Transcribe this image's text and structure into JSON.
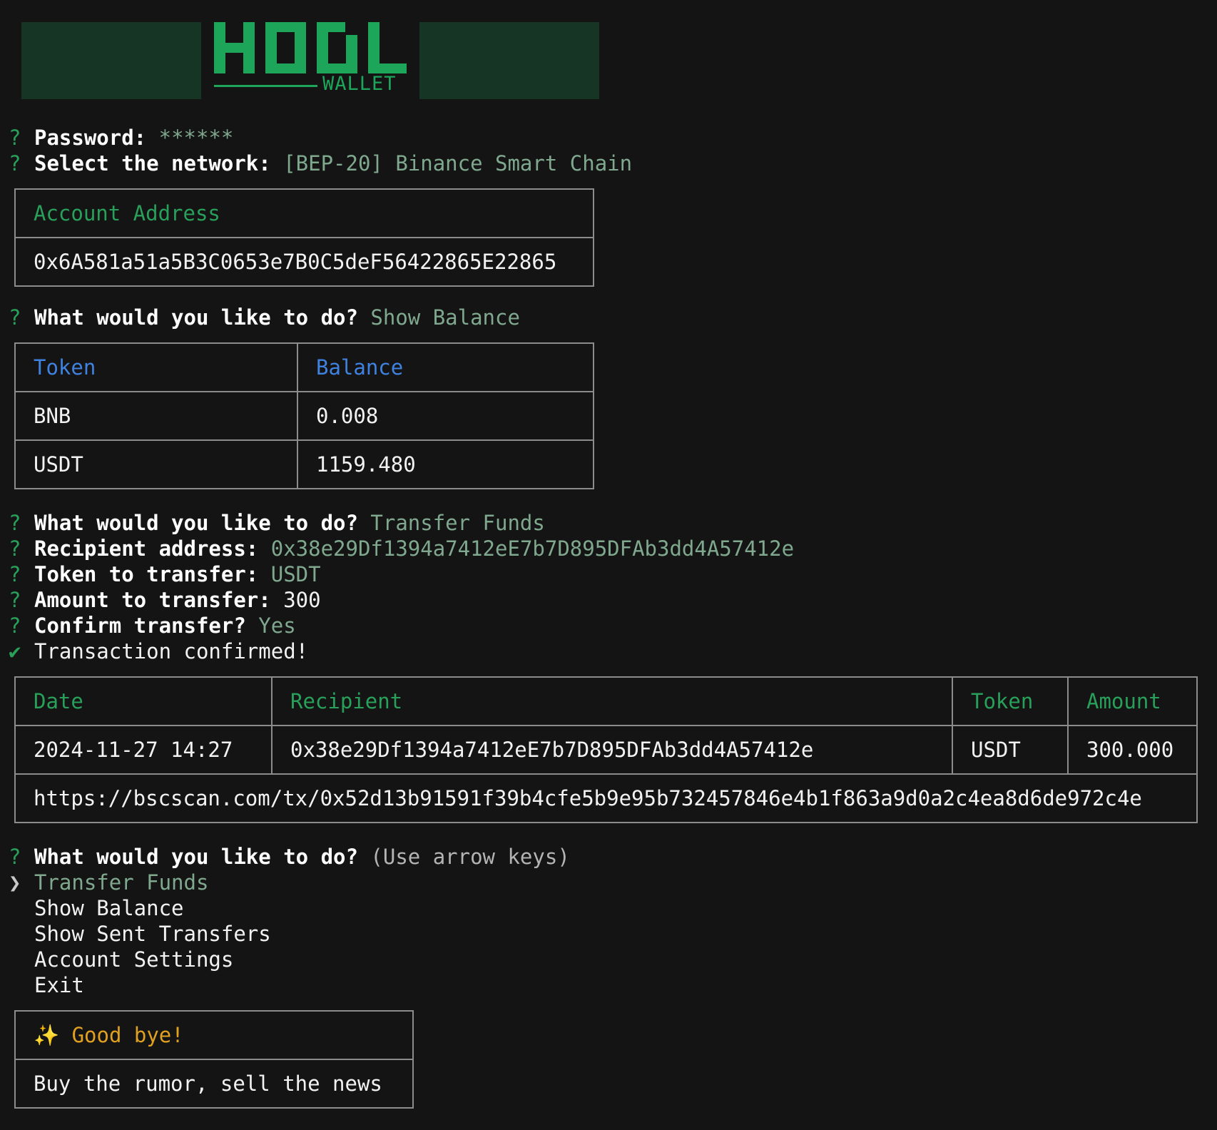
{
  "logo": {
    "title": "HODL",
    "subtitle": "WALLET"
  },
  "prompts": {
    "password": {
      "label": "Password:",
      "value": "******"
    },
    "network": {
      "label": "Select the network:",
      "value": "[BEP-20] Binance Smart Chain"
    },
    "action1": {
      "label": "What would you like to do?",
      "value": "Show Balance"
    },
    "action2": {
      "label": "What would you like to do?",
      "value": "Transfer Funds"
    },
    "recipient": {
      "label": "Recipient address:",
      "value": "0x38e29Df1394a7412eE7b7D895DFAb3dd4A57412e"
    },
    "token": {
      "label": "Token to transfer:",
      "value": "USDT"
    },
    "amount": {
      "label": "Amount to transfer:",
      "value": "300"
    },
    "confirm": {
      "label": "Confirm transfer?",
      "value": "Yes"
    },
    "confirmed": "Transaction confirmed!",
    "action3": {
      "label": "What would you like to do?",
      "hint": "(Use arrow keys)"
    }
  },
  "symbols": {
    "question": "?",
    "check": "✔",
    "pointer": "❯",
    "sparkle": "✨"
  },
  "account": {
    "header": "Account Address",
    "address": "0x6A581a51a5B3C0653e7B0C5deF56422865E22865"
  },
  "balance_table": {
    "headers": [
      "Token",
      "Balance"
    ],
    "rows": [
      [
        "BNB",
        "0.008"
      ],
      [
        "USDT",
        "1159.480"
      ]
    ]
  },
  "tx_table": {
    "headers": [
      "Date",
      "Recipient",
      "Token",
      "Amount"
    ],
    "row": [
      "2024-11-27 14:27",
      "0x38e29Df1394a7412eE7b7D895DFAb3dd4A57412e",
      "USDT",
      "300.000"
    ],
    "link": "https://bscscan.com/tx/0x52d13b91591f39b4cfe5b9e95b732457846e4b1f863a9d0a2c4ea8d6de972c4e"
  },
  "menu": {
    "items": [
      "Transfer Funds",
      "Show Balance",
      "Show Sent Transfers",
      "Account Settings",
      "Exit"
    ]
  },
  "goodbye": {
    "title": "Good bye!",
    "tagline": "Buy the rumor, sell the news"
  },
  "colors": {
    "background": "#141414",
    "accent_green": "#28a05a",
    "answer_gray_green": "#7fa88f",
    "header_blue": "#3f82e0",
    "goodbye_amber": "#e0a020",
    "logo_panel": "#173524"
  }
}
